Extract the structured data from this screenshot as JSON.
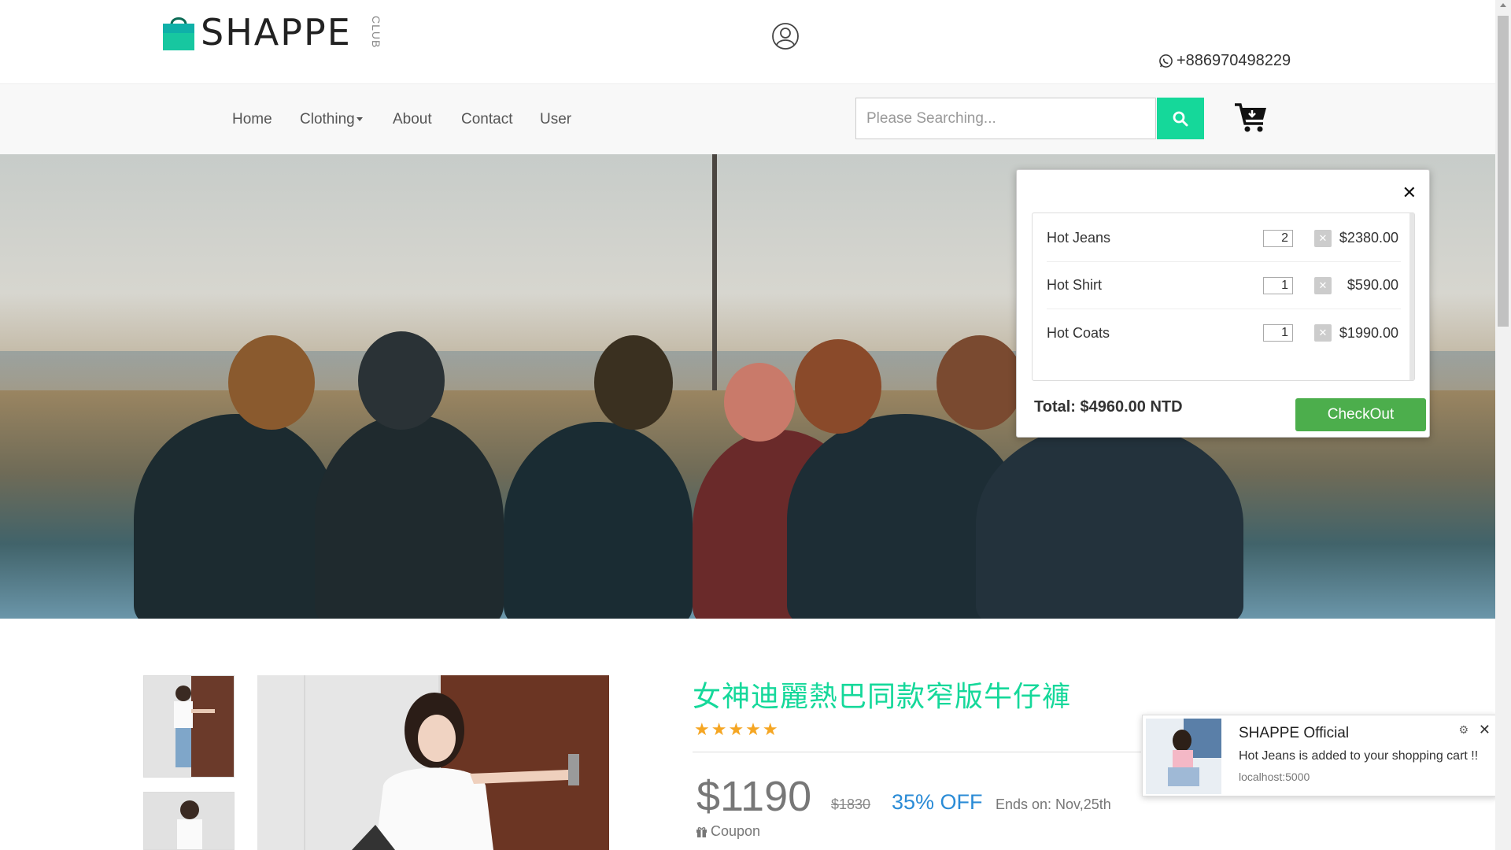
{
  "header": {
    "logo_text": "SHAPPE",
    "logo_sub": "CLUB",
    "phone": "+886970498229"
  },
  "nav": {
    "items": [
      {
        "label": "Home"
      },
      {
        "label": "Clothing"
      },
      {
        "label": "About"
      },
      {
        "label": "Contact"
      },
      {
        "label": "User"
      }
    ],
    "search_placeholder": "Please Searching..."
  },
  "cart": {
    "items": [
      {
        "name": "Hot Jeans",
        "qty": "2",
        "price": "$2380.00"
      },
      {
        "name": "Hot Shirt",
        "qty": "1",
        "price": "$590.00"
      },
      {
        "name": "Hot Coats",
        "qty": "1",
        "price": "$1990.00"
      }
    ],
    "total": "Total: $4960.00 NTD",
    "checkout_label": "CheckOut"
  },
  "product": {
    "title": "女神迪麗熱巴同款窄版牛仔褲",
    "rating_stars": "★★★★★",
    "price": "$1190",
    "old_price": "$1830",
    "discount": "35% OFF",
    "ends": "Ends on: Nov,25th",
    "coupon": "Coupon"
  },
  "notification": {
    "title": "SHAPPE Official",
    "message": "Hot Jeans is added to your shopping cart !!",
    "source": "localhost:5000"
  },
  "colors": {
    "accent": "#15d89a",
    "checkout": "#4cae4c",
    "discount": "#2a8bd6",
    "star": "#f5a623"
  }
}
